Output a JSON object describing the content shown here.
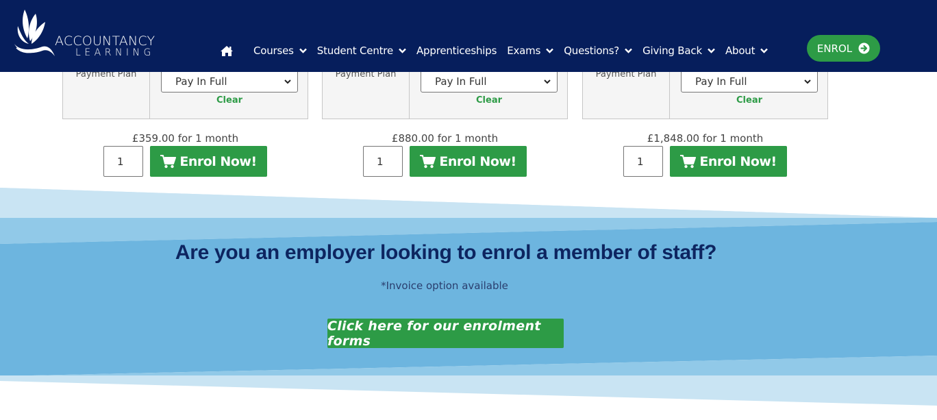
{
  "header": {
    "logo": {
      "line1": "ACCOUNTANCY",
      "line2": "LEARNING",
      "icon": "lotus-logo-icon"
    },
    "nav": [
      {
        "label": "",
        "icon": "home-icon",
        "dropdown": false
      },
      {
        "label": "Courses",
        "dropdown": true
      },
      {
        "label": "Student Centre",
        "dropdown": true
      },
      {
        "label": "Apprenticeships",
        "dropdown": false
      },
      {
        "label": "Exams",
        "dropdown": true
      },
      {
        "label": "Questions?",
        "dropdown": true
      },
      {
        "label": "Giving Back",
        "dropdown": true
      },
      {
        "label": "About",
        "dropdown": true
      }
    ],
    "enrol_button": {
      "label": "ENROL",
      "icon": "arrow-right-circle-icon"
    }
  },
  "products": [
    {
      "variation_label": "Payment Plan",
      "selected_option": "Pay In Full",
      "clear_label": "Clear",
      "price_text": "£359.00 for 1 month",
      "quantity": "1",
      "button_label": "Enrol Now!"
    },
    {
      "variation_label": "Payment Plan",
      "selected_option": "Pay In Full",
      "clear_label": "Clear",
      "price_text": "£880.00 for 1 month",
      "quantity": "1",
      "button_label": "Enrol Now!"
    },
    {
      "variation_label": "Payment Plan",
      "selected_option": "Pay In Full",
      "clear_label": "Clear",
      "price_text": "£1,848.00 for 1 month",
      "quantity": "1",
      "button_label": "Enrol Now!"
    }
  ],
  "employer": {
    "title": "Are you an employer looking to enrol a member of staff?",
    "note": "*Invoice option available",
    "button_label": "Click here for our enrolment forms"
  },
  "colors": {
    "header_bg": "#061e5c",
    "brand_green": "#2d9b46",
    "wave_light": "#c9e4f3",
    "wave_mid": "#91c9e8",
    "wave_dark": "#6db5df",
    "heading_navy": "#0d2560"
  }
}
